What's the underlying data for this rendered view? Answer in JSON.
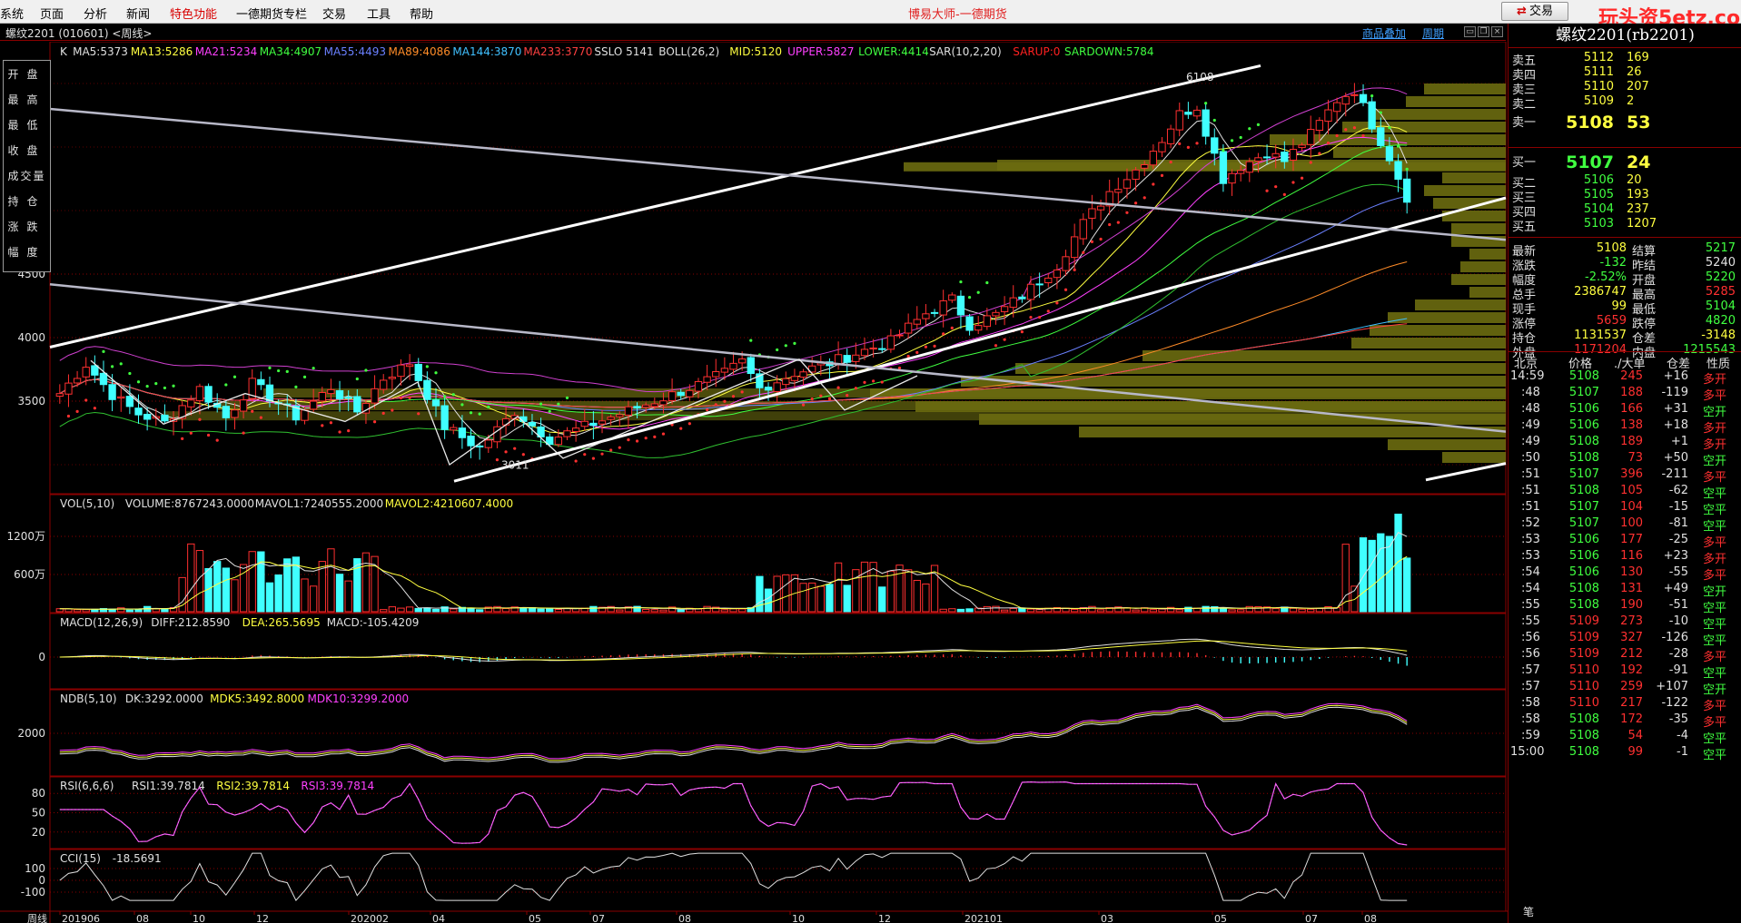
{
  "menu": {
    "items": [
      "系统",
      "页面",
      "分析",
      "新闻",
      "特色功能",
      "一德期货专栏",
      "交易",
      "工具",
      "帮助"
    ],
    "app_title": "博易大师-一德期货",
    "trade_button": "交易",
    "watermark": "玩头资5etz.com"
  },
  "header": {
    "title": "螺纹2201 (010601) <周线>",
    "link_goods": "商品叠加",
    "link_period": "周期"
  },
  "main_legend": [
    {
      "t": "K",
      "c": "#e0e0e0"
    },
    {
      "t": "MA5:5373",
      "c": "#e0e0e0"
    },
    {
      "t": "MA13:5286",
      "c": "#ffff40"
    },
    {
      "t": "MA21:5234",
      "c": "#ff40ff"
    },
    {
      "t": "MA34:4907",
      "c": "#40ff40"
    },
    {
      "t": "MA55:4493",
      "c": "#6a80ff"
    },
    {
      "t": "MA89:4086",
      "c": "#ff8c28"
    },
    {
      "t": "MA144:3870",
      "c": "#40c0ff"
    },
    {
      "t": "MA233:3770",
      "c": "#ff4040"
    },
    {
      "t": "SSLO 5141",
      "c": "#e0e0e0"
    },
    {
      "t": "BOLL(26,2)",
      "c": "#e0e0e0"
    },
    {
      "t": "MID:5120",
      "c": "#ffff40"
    },
    {
      "t": "UPPER:5827",
      "c": "#ff40ff"
    },
    {
      "t": "LOWER:4414",
      "c": "#40ff40"
    },
    {
      "t": "SAR(10,2,20)",
      "c": "#e0e0e0"
    },
    {
      "t": "SARUP:0",
      "c": "#ff2020"
    },
    {
      "t": "SARDOWN:5784",
      "c": "#40ff40"
    }
  ],
  "infobox": [
    "开盘",
    "最高",
    "最低",
    "收盘",
    "成交量",
    "持仓",
    "涨跌",
    "幅度"
  ],
  "price_ticks": [
    "4500",
    "4000",
    "3500"
  ],
  "marks": {
    "high": "6108",
    "low": "3011"
  },
  "vol": {
    "legend": [
      {
        "t": "VOL(5,10)",
        "c": "#e0e0e0"
      },
      {
        "t": "VOLUME:8767243.0000",
        "c": "#e0e0e0"
      },
      {
        "t": "MAVOL1:7240555.2000",
        "c": "#e0e0e0"
      },
      {
        "t": "MAVOL2:4210607.4000",
        "c": "#ffff40"
      }
    ],
    "ticks": [
      "1200万",
      "600万"
    ]
  },
  "macd": {
    "legend": [
      {
        "t": "MACD(12,26,9)",
        "c": "#e0e0e0"
      },
      {
        "t": "DIFF:212.8590",
        "c": "#e0e0e0"
      },
      {
        "t": "DEA:265.5695",
        "c": "#ffff40"
      },
      {
        "t": "MACD:-105.4209",
        "c": "#e0e0e0"
      }
    ],
    "ticks": [
      "0"
    ]
  },
  "ndb": {
    "legend": [
      {
        "t": "NDB(5,10)",
        "c": "#e0e0e0"
      },
      {
        "t": "DK:3292.0000",
        "c": "#e0e0e0"
      },
      {
        "t": "MDK5:3492.8000",
        "c": "#ffff40"
      },
      {
        "t": "MDK10:3299.2000",
        "c": "#ff40ff"
      }
    ],
    "ticks": [
      "2000"
    ]
  },
  "rsi": {
    "legend": [
      {
        "t": "RSI(6,6,6)",
        "c": "#e0e0e0"
      },
      {
        "t": "RSI1:39.7814",
        "c": "#e0e0e0"
      },
      {
        "t": "RSI2:39.7814",
        "c": "#ffff40"
      },
      {
        "t": "RSI3:39.7814",
        "c": "#ff40ff"
      }
    ],
    "ticks": [
      "80",
      "50",
      "20"
    ]
  },
  "cci": {
    "legend": [
      {
        "t": "CCI(15)",
        "c": "#e0e0e0"
      },
      {
        "t": "-18.5691",
        "c": "#e0e0e0"
      }
    ],
    "ticks": [
      "100",
      "0",
      "-100"
    ]
  },
  "xaxis": {
    "label": "周线",
    "ticks": [
      "201906",
      "08",
      "10",
      "12",
      "202002",
      "04",
      "05",
      "07",
      "08",
      "10",
      "12",
      "202101",
      "03",
      "05",
      "07",
      "08"
    ]
  },
  "rpanel": {
    "title": "螺纹2201(rb2201)",
    "asks": [
      {
        "label": "卖五",
        "price": "5112",
        "vol": "169"
      },
      {
        "label": "卖四",
        "price": "5111",
        "vol": "26"
      },
      {
        "label": "卖三",
        "price": "5110",
        "vol": "207"
      },
      {
        "label": "卖二",
        "price": "5109",
        "vol": "2"
      },
      {
        "label": "卖一",
        "price": "5108",
        "vol": "53"
      }
    ],
    "bids": [
      {
        "label": "买一",
        "price": "5107",
        "vol": "24"
      },
      {
        "label": "买二",
        "price": "5106",
        "vol": "20"
      },
      {
        "label": "买三",
        "price": "5105",
        "vol": "193"
      },
      {
        "label": "买四",
        "price": "5104",
        "vol": "237"
      },
      {
        "label": "买五",
        "price": "5103",
        "vol": "1207"
      }
    ],
    "stats": [
      {
        "l1": "最新",
        "v1": "5108",
        "c1": "yel",
        "l2": "结算",
        "v2": "5217",
        "c2": "grn"
      },
      {
        "l1": "涨跌",
        "v1": "-132",
        "c1": "grn",
        "l2": "昨结",
        "v2": "5240",
        "c2": "wht"
      },
      {
        "l1": "幅度",
        "v1": "-2.52%",
        "c1": "grn",
        "l2": "开盘",
        "v2": "5220",
        "c2": "grn"
      },
      {
        "l1": "总手",
        "v1": "2386747",
        "c1": "yel",
        "l2": "最高",
        "v2": "5285",
        "c2": "red"
      },
      {
        "l1": "现手",
        "v1": "99",
        "c1": "yel",
        "l2": "最低",
        "v2": "5104",
        "c2": "grn"
      },
      {
        "l1": "涨停",
        "v1": "5659",
        "c1": "red",
        "l2": "跌停",
        "v2": "4820",
        "c2": "grn"
      },
      {
        "l1": "持仓",
        "v1": "1131537",
        "c1": "yel",
        "l2": "仓差",
        "v2": "-3148",
        "c2": "yel"
      },
      {
        "l1": "外盘",
        "v1": "1171204",
        "c1": "red",
        "l2": "内盘",
        "v2": "1215543",
        "c2": "grn"
      }
    ],
    "tick_header": {
      "time": "北京",
      "price": "价格",
      "big": "./大单",
      "oi": "仓差",
      "nature": "性质"
    },
    "ticks": [
      {
        "t": "14:59",
        "p": "5108",
        "v": "245",
        "d": "+16",
        "n": "多开"
      },
      {
        "t": ":48",
        "p": "5107",
        "v": "188",
        "d": "-119",
        "n": "多平"
      },
      {
        "t": ":48",
        "p": "5106",
        "v": "166",
        "d": "+31",
        "n": "空开"
      },
      {
        "t": ":49",
        "p": "5106",
        "v": "138",
        "d": "+18",
        "n": "多开"
      },
      {
        "t": ":49",
        "p": "5108",
        "v": "189",
        "d": "+1",
        "n": "多开"
      },
      {
        "t": ":50",
        "p": "5108",
        "v": "73",
        "d": "+50",
        "n": "空开"
      },
      {
        "t": ":51",
        "p": "5107",
        "v": "396",
        "d": "-211",
        "n": "多平"
      },
      {
        "t": ":51",
        "p": "5108",
        "v": "105",
        "d": "-62",
        "n": "空平"
      },
      {
        "t": ":51",
        "p": "5107",
        "v": "104",
        "d": "-15",
        "n": "空平"
      },
      {
        "t": ":52",
        "p": "5107",
        "v": "100",
        "d": "-81",
        "n": "空平"
      },
      {
        "t": ":53",
        "p": "5106",
        "v": "177",
        "d": "-25",
        "n": "多平"
      },
      {
        "t": ":53",
        "p": "5106",
        "v": "116",
        "d": "+23",
        "n": "多开"
      },
      {
        "t": ":54",
        "p": "5106",
        "v": "130",
        "d": "-55",
        "n": "多平"
      },
      {
        "t": ":54",
        "p": "5108",
        "v": "131",
        "d": "+49",
        "n": "空开"
      },
      {
        "t": ":55",
        "p": "5108",
        "v": "190",
        "d": "-51",
        "n": "空平"
      },
      {
        "t": ":55",
        "p": "5109",
        "v": "273",
        "d": "-10",
        "n": "空平"
      },
      {
        "t": ":56",
        "p": "5109",
        "v": "327",
        "d": "-126",
        "n": "空平"
      },
      {
        "t": ":56",
        "p": "5109",
        "v": "212",
        "d": "-28",
        "n": "多平"
      },
      {
        "t": ":57",
        "p": "5110",
        "v": "192",
        "d": "-91",
        "n": "空平"
      },
      {
        "t": ":57",
        "p": "5110",
        "v": "259",
        "d": "+107",
        "n": "空开"
      },
      {
        "t": ":58",
        "p": "5110",
        "v": "217",
        "d": "-122",
        "n": "多平"
      },
      {
        "t": ":58",
        "p": "5108",
        "v": "172",
        "d": "-35",
        "n": "多平"
      },
      {
        "t": ":59",
        "p": "5108",
        "v": "54",
        "d": "-4",
        "n": "空平"
      },
      {
        "t": "15:00",
        "p": "5108",
        "v": "99",
        "d": "-1",
        "n": "空平"
      }
    ],
    "bottom_label": "笔"
  },
  "chart_data": {
    "type": "candlestick",
    "weeks": 120,
    "price_range": [
      2800,
      6300
    ],
    "vol_range": [
      0,
      16000000
    ],
    "keypoints": [
      [
        0,
        3560
      ],
      [
        3,
        3790
      ],
      [
        6,
        3550
      ],
      [
        9,
        3400
      ],
      [
        12,
        3330
      ],
      [
        16,
        3600
      ],
      [
        19,
        3370
      ],
      [
        22,
        3640
      ],
      [
        27,
        3380
      ],
      [
        31,
        3610
      ],
      [
        34,
        3420
      ],
      [
        37,
        3680
      ],
      [
        40,
        3800
      ],
      [
        44,
        3300
      ],
      [
        48,
        3130
      ],
      [
        52,
        3420
      ],
      [
        56,
        3200
      ],
      [
        60,
        3300
      ],
      [
        64,
        3400
      ],
      [
        68,
        3500
      ],
      [
        73,
        3630
      ],
      [
        76,
        3720
      ],
      [
        78,
        3810
      ],
      [
        80,
        3600
      ],
      [
        84,
        3720
      ],
      [
        88,
        3800
      ],
      [
        92,
        3900
      ],
      [
        95,
        3970
      ],
      [
        99,
        4190
      ],
      [
        102,
        4300
      ],
      [
        104,
        4100
      ],
      [
        107,
        4180
      ],
      [
        110,
        4330
      ],
      [
        114,
        4570
      ],
      [
        117,
        4900
      ],
      [
        120,
        5150
      ],
      [
        123,
        5320
      ],
      [
        126,
        5560
      ],
      [
        128,
        5760
      ],
      [
        130,
        5820
      ],
      [
        133,
        5250
      ],
      [
        135,
        5350
      ],
      [
        138,
        5460
      ],
      [
        140,
        5390
      ],
      [
        143,
        5600
      ],
      [
        146,
        5870
      ],
      [
        148,
        5950
      ],
      [
        150,
        5680
      ],
      [
        152,
        5420
      ],
      [
        154,
        5108
      ]
    ],
    "volume_profile_note": "horizontal volume-at-price bars on the right side of the price chart"
  }
}
